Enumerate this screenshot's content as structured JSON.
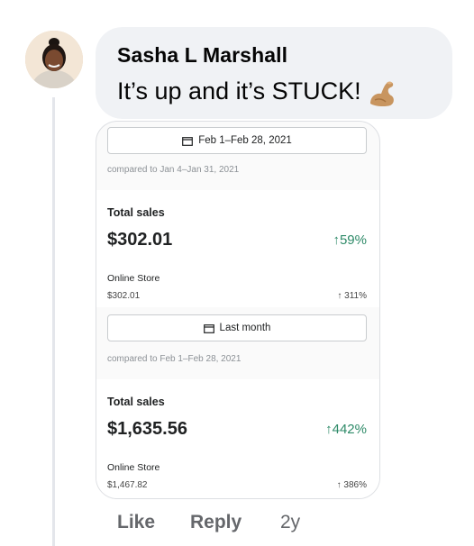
{
  "comment": {
    "author": "Sasha L Marshall",
    "text": "It’s up and it’s STUCK!",
    "emoji_icon": "flexed-biceps-emoji"
  },
  "screenshot": {
    "period1": {
      "date_button": "Feb 1–Feb 28, 2021",
      "compared_to": "compared to Jan 4–Jan 31, 2021",
      "total_sales_label": "Total sales",
      "total_sales_value": "$302.01",
      "total_sales_change": "↑59%",
      "channel_label": "Online Store",
      "channel_value": "$302.01",
      "channel_change": "↑ 311%"
    },
    "period2": {
      "date_button": "Last month",
      "compared_to": "compared to Feb 1–Feb 28, 2021",
      "total_sales_label": "Total sales",
      "total_sales_value": "$1,635.56",
      "total_sales_change": "↑442%",
      "channel_label": "Online Store",
      "channel_value": "$1,467.82",
      "channel_change": "↑ 386%"
    }
  },
  "actions": {
    "like": "Like",
    "reply": "Reply",
    "time": "2y"
  },
  "colors": {
    "bubble": "#f0f2f5",
    "positive": "#2e8a68",
    "muted": "#65676b"
  }
}
